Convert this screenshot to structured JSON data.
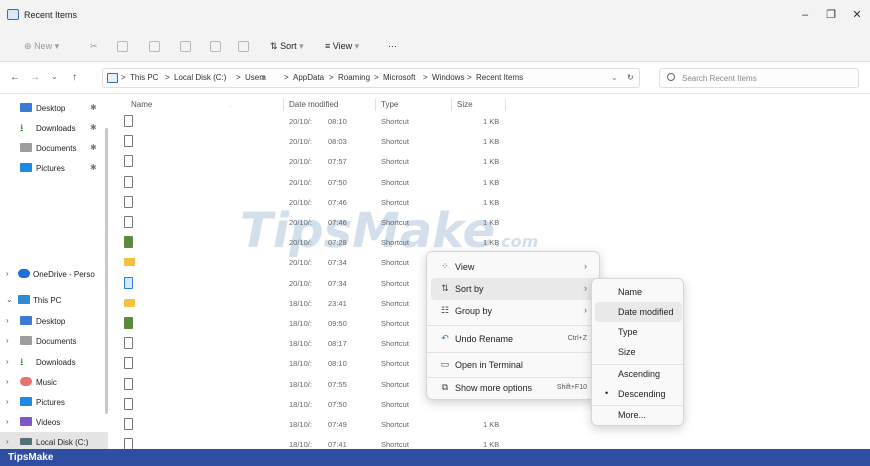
{
  "window": {
    "title": "Recent Items",
    "controls": {
      "minimize": "–",
      "maximize": "❐",
      "close": "✕"
    }
  },
  "toolbar": {
    "new_label": "New",
    "sort_label": "Sort",
    "view_label": "View",
    "more_label": "···"
  },
  "address": {
    "crumbs": [
      "This PC",
      "Local Disk (C:)",
      "Users",
      "AppData",
      "Roaming",
      "Microsoft",
      "Windows",
      "Recent Items"
    ],
    "separator": ">",
    "search_placeholder": "Search Recent Items"
  },
  "sidebar": {
    "quick": [
      {
        "label": "Desktop",
        "icon": "desktop-icon",
        "color": "#3a7bd5"
      },
      {
        "label": "Downloads",
        "icon": "download-icon",
        "color": "#2e7d32"
      },
      {
        "label": "Documents",
        "icon": "documents-icon",
        "color": "#9e9e9e"
      },
      {
        "label": "Pictures",
        "icon": "pictures-icon",
        "color": "#1e88e5"
      }
    ],
    "onedrive_label": "OneDrive - Perso",
    "thispc_label": "This PC",
    "thispc_children": [
      {
        "label": "Desktop",
        "icon": "desktop-icon",
        "color": "#3a7bd5"
      },
      {
        "label": "Documents",
        "icon": "documents-icon",
        "color": "#9e9e9e"
      },
      {
        "label": "Downloads",
        "icon": "download-icon",
        "color": "#2e7d32"
      },
      {
        "label": "Music",
        "icon": "music-icon",
        "color": "#e57373"
      },
      {
        "label": "Pictures",
        "icon": "pictures-icon",
        "color": "#1e88e5"
      },
      {
        "label": "Videos",
        "icon": "videos-icon",
        "color": "#7e57c2"
      },
      {
        "label": "Local Disk (C:)",
        "icon": "drive-icon",
        "color": "#546e7a"
      }
    ]
  },
  "columns": {
    "name": "Name",
    "date": "Date modified",
    "type": "Type",
    "size": "Size"
  },
  "rows": [
    {
      "icon": "file",
      "date": "20/10/:",
      "time": "08:10",
      "type": "Shortcut",
      "size": "1 KB"
    },
    {
      "icon": "file",
      "date": "20/10/:",
      "time": "08:03",
      "type": "Shortcut",
      "size": "1 KB"
    },
    {
      "icon": "file",
      "date": "20/10/:",
      "time": "07:57",
      "type": "Shortcut",
      "size": "1 KB"
    },
    {
      "icon": "file",
      "date": "20/10/:",
      "time": "07:50",
      "type": "Shortcut",
      "size": "1 KB"
    },
    {
      "icon": "file",
      "date": "20/10/:",
      "time": "07:46",
      "type": "Shortcut",
      "size": "1 KB"
    },
    {
      "icon": "file",
      "date": "20/10/:",
      "time": "07:46",
      "type": "Shortcut",
      "size": "1 KB"
    },
    {
      "icon": "img",
      "date": "20/10/:",
      "time": "07:28",
      "type": "Shortcut",
      "size": "1 KB"
    },
    {
      "icon": "folder",
      "date": "20/10/:",
      "time": "07:34",
      "type": "Shortcut",
      "size": ""
    },
    {
      "icon": "app",
      "date": "20/10/:",
      "time": "07:34",
      "type": "Shortcut",
      "size": ""
    },
    {
      "icon": "folder",
      "date": "18/10/:",
      "time": "23:41",
      "type": "Shortcut",
      "size": ""
    },
    {
      "icon": "img",
      "date": "18/10/:",
      "time": "09:50",
      "type": "Shortcut",
      "size": ""
    },
    {
      "icon": "file",
      "date": "18/10/:",
      "time": "08:17",
      "type": "Shortcut",
      "size": ""
    },
    {
      "icon": "file",
      "date": "18/10/:",
      "time": "08:10",
      "type": "Shortcut",
      "size": ""
    },
    {
      "icon": "file",
      "date": "18/10/:",
      "time": "07:55",
      "type": "Shortcut",
      "size": ""
    },
    {
      "icon": "file",
      "date": "18/10/:",
      "time": "07:50",
      "type": "Shortcut",
      "size": ""
    },
    {
      "icon": "file",
      "date": "18/10/:",
      "time": "07:49",
      "type": "Shortcut",
      "size": "1 KB"
    },
    {
      "icon": "file",
      "date": "18/10/:",
      "time": "07:41",
      "type": "Shortcut",
      "size": "1 KB"
    }
  ],
  "context_menu": [
    {
      "label": "View",
      "icon": "view-icon",
      "glyph": "⁘",
      "submenu": true,
      "shortcut": ""
    },
    {
      "label": "Sort by",
      "icon": "sort-icon",
      "glyph": "⇅",
      "submenu": true,
      "shortcut": "",
      "hover": true
    },
    {
      "label": "Group by",
      "icon": "group-icon",
      "glyph": "☷",
      "submenu": true,
      "shortcut": ""
    },
    {
      "label": "Undo Rename",
      "icon": "undo-icon",
      "glyph": "↶",
      "submenu": false,
      "shortcut": "Ctrl+Z"
    },
    {
      "label": "Open in Terminal",
      "icon": "terminal-icon",
      "glyph": "▭",
      "submenu": false,
      "shortcut": ""
    },
    {
      "label": "Show more options",
      "icon": "more-options-icon",
      "glyph": "⧉",
      "submenu": false,
      "shortcut": "Shift+F10"
    }
  ],
  "sort_submenu": {
    "fields": [
      "Name",
      "Date modified",
      "Type",
      "Size"
    ],
    "hover_field": "Date modified",
    "order": [
      "Ascending",
      "Descending"
    ],
    "selected_order": "Descending",
    "more_label": "More..."
  },
  "watermark": {
    "main": "TipsMake",
    "suffix": ".com"
  },
  "brand_footer": "TipsMake",
  "colors": {
    "accent": "#2f4ea1",
    "folder": "#f3c243"
  }
}
